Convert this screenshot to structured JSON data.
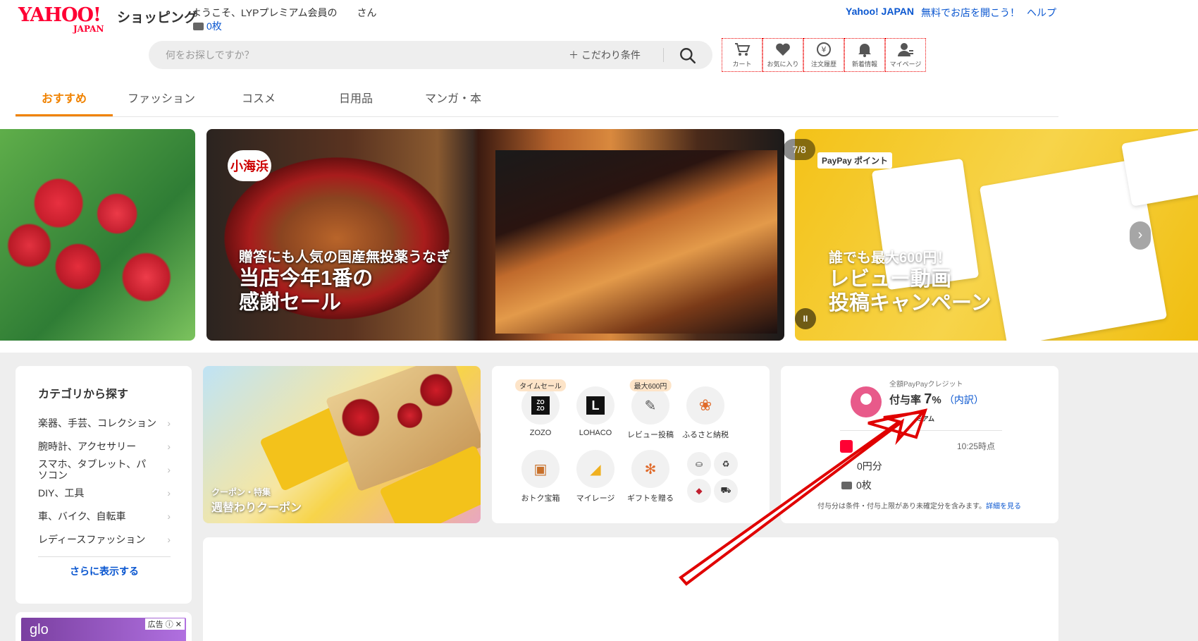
{
  "header": {
    "logo_text": "YAHOO!",
    "logo_sub": "JAPAN",
    "shop_name": "ショッピング",
    "welcome": "ようこそ、LYPプレミアム会員の　　さん",
    "coupon_count": "0枚",
    "top_links": {
      "yahoo_japan": "Yahoo! JAPAN",
      "open_store": "無料でお店を開こう！",
      "help": "ヘルプ"
    }
  },
  "search": {
    "placeholder": "何をお探しですか？",
    "kodawari": "＋ こだわり条件"
  },
  "icon_nav": [
    {
      "label": "カート",
      "icon": "cart-icon"
    },
    {
      "label": "お気に入り",
      "icon": "heart-icon"
    },
    {
      "label": "注文履歴",
      "icon": "yen-history-icon"
    },
    {
      "label": "新着情報",
      "icon": "bell-icon"
    },
    {
      "label": "マイページ",
      "icon": "user-icon"
    }
  ],
  "tabs": [
    "おすすめ",
    "ファッション",
    "コスメ",
    "日用品",
    "マンガ・本"
  ],
  "banners": {
    "unagi": {
      "brand": "小海浜",
      "subtitle": "贈答にも人気の国産無投薬うなぎ",
      "title_line1": "当店今年1番の",
      "title_line2": "感謝セール"
    },
    "review": {
      "badge": "PayPay ポイント",
      "subtitle": "誰でも最大600円！",
      "title_line1": "レビュー動画",
      "title_line2": "投稿キャンペーン"
    },
    "pager": "7/8",
    "pause": "II",
    "next": "›"
  },
  "categories": {
    "title": "カテゴリから探す",
    "items": [
      "楽器、手芸、コレクション",
      "腕時計、アクセサリー",
      "スマホ、タブレット、パソコン",
      "DIY、工具",
      "車、バイク、自転車",
      "レディースファッション"
    ],
    "more": "さらに表示する"
  },
  "ad": {
    "brand": "glo",
    "tag": "広告 ⓘ ✕"
  },
  "coupon_card": {
    "small": "クーポン・特集",
    "title": "週替わりクーポン"
  },
  "services": {
    "row1": [
      {
        "label": "ZOZO",
        "badge": "タイムセール",
        "glyph": "ZO\nZO"
      },
      {
        "label": "LOHACO",
        "badge": "",
        "glyph": "L"
      },
      {
        "label": "レビュー投稿",
        "badge": "最大600円",
        "glyph": "✎"
      },
      {
        "label": "ふるさと納税",
        "badge": "",
        "glyph": "❀"
      }
    ],
    "row2": [
      {
        "label": "おトク宝箱",
        "glyph": "▣"
      },
      {
        "label": "マイレージ",
        "glyph": "◢"
      },
      {
        "label": "ギフトを贈る",
        "glyph": "✻"
      }
    ]
  },
  "paypay": {
    "label": "全額PayPayクレジット",
    "rate_prefix": "付与率",
    "rate_value": "7",
    "rate_unit": "%",
    "rate_link": "（内訳）",
    "premium": "LYPプレミアム",
    "time": "10:25時点",
    "points": "0円分",
    "coupons": "0枚",
    "note": "付与分は条件・付与上限があり未確定分を含みます。",
    "note_link": "詳細を見る"
  },
  "colors": {
    "brand_red": "#ff0033",
    "accent_orange": "#f08200",
    "link_blue": "#0b57d0",
    "annotation_arrow": "#e00000"
  }
}
